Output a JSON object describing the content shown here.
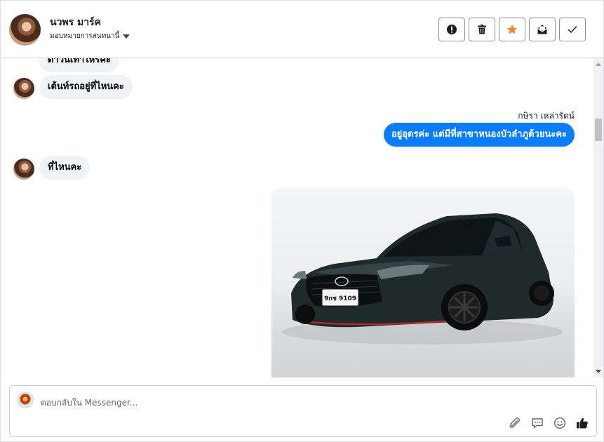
{
  "header": {
    "contact_name": "นวพร มาร์ค",
    "assign_label": "มอบหมายการสนทนานี้",
    "actions": [
      {
        "name": "mark-spam-button",
        "icon": "exclamation-circle-icon"
      },
      {
        "name": "delete-button",
        "icon": "trash-icon"
      },
      {
        "name": "star-button",
        "icon": "star-icon"
      },
      {
        "name": "mark-unread-button",
        "icon": "envelope-icon"
      },
      {
        "name": "mark-done-button",
        "icon": "checkmark-icon"
      }
    ]
  },
  "messages": [
    {
      "direction": "in",
      "text": "ดาวนเทาไหรคะ"
    },
    {
      "direction": "in",
      "text": "เต้นท์รถอยู่ที่ไหนคะ"
    },
    {
      "direction": "out",
      "sender": "กษิรา เหล่ารัตน์",
      "text": "อยู่อุดรค่ะ แต่มีที่สาขาหนองบัวลำภูด้วยนะคะ"
    },
    {
      "direction": "in",
      "text": "ที่ไหนคะ"
    },
    {
      "direction": "out",
      "type": "image",
      "plate": "9กช 9109"
    }
  ],
  "composer": {
    "placeholder": "ตอบกลับใน Messenger...",
    "icons": [
      "paperclip-icon",
      "saved-reply-icon",
      "emoji-icon",
      "thumbs-up-icon"
    ]
  },
  "colors": {
    "accent": "#0a7cff",
    "star": "#f5821f",
    "incoming_bubble": "#f0f2f5"
  }
}
